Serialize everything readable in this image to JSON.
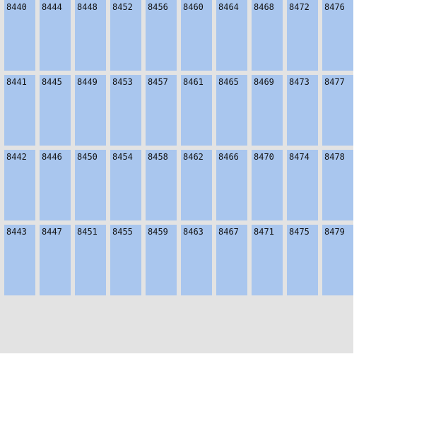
{
  "colors": {
    "tile": "#a9c6ee",
    "container": "#e3e3e3",
    "page": "#ffffff"
  },
  "tiles": [
    "8440",
    "8444",
    "8448",
    "8452",
    "8456",
    "8460",
    "8464",
    "8468",
    "8472",
    "8476",
    "8441",
    "8445",
    "8449",
    "8453",
    "8457",
    "8461",
    "8465",
    "8469",
    "8473",
    "8477",
    "8442",
    "8446",
    "8450",
    "8454",
    "8458",
    "8462",
    "8466",
    "8470",
    "8474",
    "8478",
    "8443",
    "8447",
    "8451",
    "8455",
    "8459",
    "8463",
    "8467",
    "8471",
    "8475",
    "8479"
  ]
}
